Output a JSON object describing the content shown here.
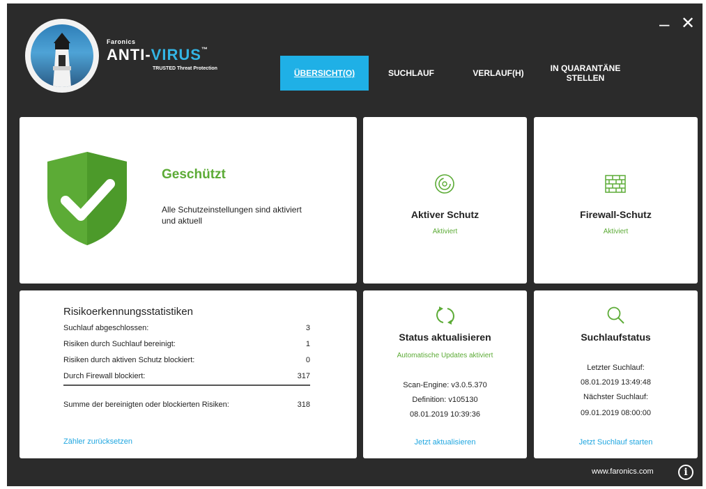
{
  "app": {
    "brand_small": "Faronics",
    "brand_anti": "ANTI-",
    "brand_virus": "VIRUS",
    "brand_tm": "™",
    "brand_sub": "TRUSTED Threat Protection",
    "minimize_glyph": "–",
    "close_glyph": "✕"
  },
  "nav": {
    "overview": "ÜBERSICHT(O)",
    "scan": "SUCHLAUF",
    "history": "VERLAUF(H)",
    "quarantine_line1": "IN QUARANTÄNE",
    "quarantine_line2": "STELLEN"
  },
  "status_card": {
    "title": "Geschützt",
    "desc_line1": "Alle Schutzeinstellungen sind aktiviert",
    "desc_line2": "und aktuell"
  },
  "active_protection": {
    "title": "Aktiver Schutz",
    "status": "Aktiviert",
    "icon": "active-protection-icon"
  },
  "firewall": {
    "title": "Firewall-Schutz",
    "status": "Aktiviert",
    "icon": "firewall-icon"
  },
  "stats": {
    "title": "Risikoerkennungsstatistiken",
    "rows": [
      {
        "label": "Suchlauf abgeschlossen:",
        "value": "3"
      },
      {
        "label": "Risiken durch Suchlauf bereinigt:",
        "value": "1"
      },
      {
        "label": "Risiken durch aktiven Schutz blockiert:",
        "value": "0"
      },
      {
        "label": "Durch Firewall blockiert:",
        "value": "317"
      }
    ],
    "total_label": "Summe der bereinigten oder blockierten Risiken:",
    "total_value": "318",
    "reset_link": "Zähler zurücksetzen"
  },
  "update": {
    "title": "Status aktualisieren",
    "subtitle": "Automatische Updates aktiviert",
    "engine": "Scan-Engine: v3.0.5.370",
    "definition": "Definition: v105130",
    "date": "08.01.2019 10:39:36",
    "link": "Jetzt aktualisieren"
  },
  "scan_status": {
    "title": "Suchlaufstatus",
    "last_label": "Letzter Suchlauf:",
    "last_value": "08.01.2019 13:49:48",
    "next_label": "Nächster Suchlauf:",
    "next_value": "09.01.2019 08:00:00",
    "link": "Jetzt Suchlauf starten"
  },
  "footer": {
    "url": "www.faronics.com",
    "info_glyph": "i"
  },
  "colors": {
    "accent": "#1fb0e6",
    "green": "#5cab36",
    "background": "#2b2b2b"
  }
}
